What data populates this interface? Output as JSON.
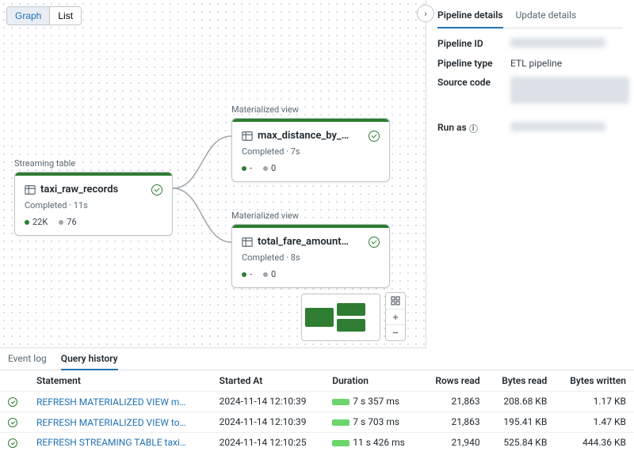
{
  "viewToggle": {
    "graph": "Graph",
    "list": "List"
  },
  "nodes": {
    "n1": {
      "type": "Streaming table",
      "title": "taxi_raw_records",
      "status": "Completed · 11s",
      "stat1": "22K",
      "stat2": "76"
    },
    "n2": {
      "type": "Materialized view",
      "title": "max_distance_by_…",
      "status": "Completed · 7s",
      "stat1": "-",
      "stat2": "0"
    },
    "n3": {
      "type": "Materialized view",
      "title": "total_fare_amount…",
      "status": "Completed · 8s",
      "stat1": "-",
      "stat2": "0"
    }
  },
  "details": {
    "tab1": "Pipeline details",
    "tab2": "Update details",
    "k1": "Pipeline ID",
    "k2": "Pipeline type",
    "v2": "ETL pipeline",
    "k3": "Source code",
    "k4": "Run as"
  },
  "bottomTabs": {
    "event": "Event log",
    "query": "Query history"
  },
  "table": {
    "h1": "Statement",
    "h2": "Started At",
    "h3": "Duration",
    "h4": "Rows read",
    "h5": "Bytes read",
    "h6": "Bytes written",
    "rows": [
      {
        "stmt": "REFRESH MATERIALIZED VIEW max_di…",
        "started": "2024-11-14 12:10:39",
        "dur": "7 s 357 ms",
        "rows": "21,863",
        "bread": "208.68 KB",
        "bwrite": "1.17 KB"
      },
      {
        "stmt": "REFRESH MATERIALIZED VIEW total_fa…",
        "started": "2024-11-14 12:10:39",
        "dur": "7 s 703 ms",
        "rows": "21,863",
        "bread": "195.41 KB",
        "bwrite": "1.47 KB"
      },
      {
        "stmt": "REFRESH STREAMING TABLE taxi_raw…",
        "started": "2024-11-14 12:10:25",
        "dur": "11 s 426 ms",
        "rows": "21,940",
        "bread": "525.84 KB",
        "bwrite": "444.36 KB"
      }
    ]
  }
}
